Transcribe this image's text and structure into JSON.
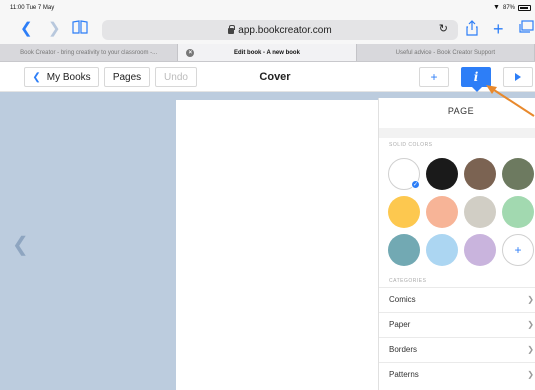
{
  "status": {
    "time": "11:00  Tue 7 May",
    "battery": "87%"
  },
  "browser": {
    "url": "app.bookcreator.com",
    "tabs": [
      {
        "title": "Book Creator - bring creativity to your classroom -...",
        "active": false
      },
      {
        "title": "Edit book - A new book",
        "active": true
      },
      {
        "title": "Useful advice - Book Creator Support",
        "active": false
      }
    ]
  },
  "toolbar": {
    "my_books": "My Books",
    "pages": "Pages",
    "undo": "Undo",
    "title": "Cover",
    "add": "+",
    "info": "i"
  },
  "panel": {
    "title": "PAGE",
    "solid_colors_label": "SOLID COLORS",
    "colors": [
      "#ffffff",
      "#1a1a1a",
      "#7b6352",
      "#6d7a60",
      "#fdc84f",
      "#f7b497",
      "#d1cec5",
      "#a2d9b0",
      "#72a9b3",
      "#acd6f2",
      "#c9b4dd"
    ],
    "selected_color": 0,
    "add_label": "+",
    "categories_label": "CATEGORIES",
    "categories": [
      "Comics",
      "Paper",
      "Borders",
      "Patterns"
    ]
  },
  "accent": "#2d7ef7",
  "annotation_color": "#e8892d"
}
